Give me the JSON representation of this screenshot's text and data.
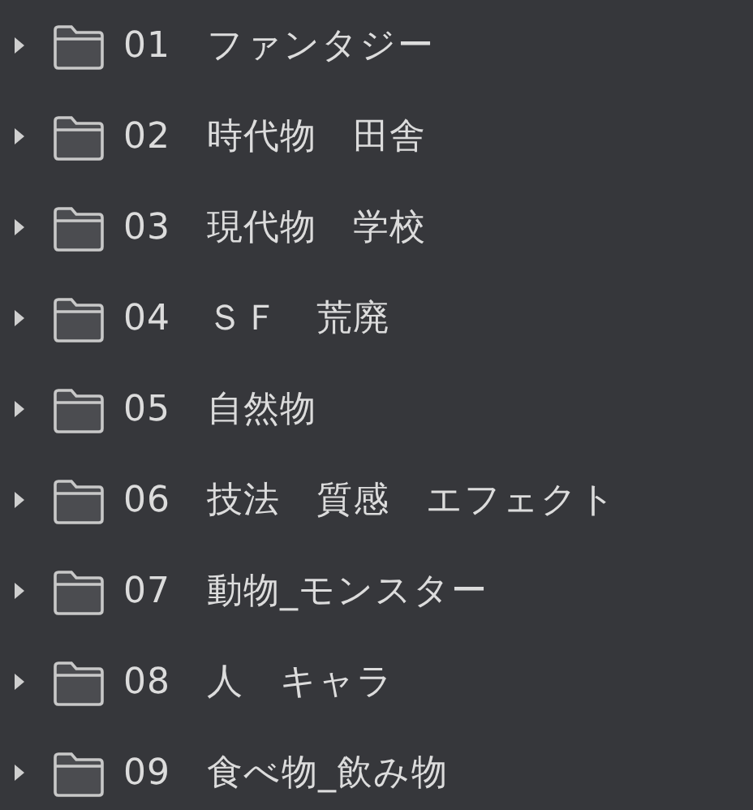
{
  "folders": [
    {
      "name": "01　ファンタジー",
      "expanded": false
    },
    {
      "name": "02　時代物　田舎",
      "expanded": false
    },
    {
      "name": "03　現代物　学校",
      "expanded": false
    },
    {
      "name": "04　ＳＦ　荒廃",
      "expanded": false
    },
    {
      "name": "05　自然物",
      "expanded": false
    },
    {
      "name": "06　技法　質感　エフェクト",
      "expanded": false
    },
    {
      "name": "07　動物_モンスター",
      "expanded": false
    },
    {
      "name": "08　人　キャラ",
      "expanded": false
    },
    {
      "name": "09　食べ物_飲み物",
      "expanded": false
    }
  ]
}
